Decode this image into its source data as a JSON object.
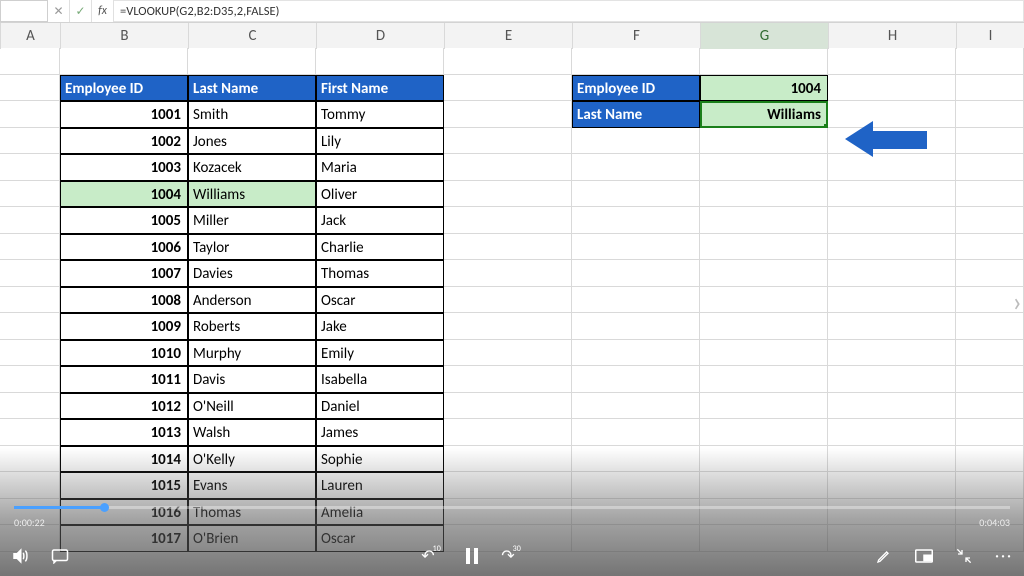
{
  "formula_bar": {
    "cancel_glyph": "✕",
    "accept_glyph": "✓",
    "fx_label": "fx",
    "formula": "=VLOOKUP(G2,B2:D35,2,FALSE)"
  },
  "columns": [
    "A",
    "B",
    "C",
    "D",
    "E",
    "F",
    "G",
    "H",
    "I"
  ],
  "selected_column": "G",
  "table": {
    "headers": [
      "Employee ID",
      "Last Name",
      "First Name"
    ],
    "rows": [
      {
        "id": "1001",
        "last": "Smith",
        "first": "Tommy"
      },
      {
        "id": "1002",
        "last": "Jones",
        "first": "Lily"
      },
      {
        "id": "1003",
        "last": "Kozacek",
        "first": "Maria"
      },
      {
        "id": "1004",
        "last": "Williams",
        "first": "Oliver",
        "highlight": true
      },
      {
        "id": "1005",
        "last": "Miller",
        "first": "Jack"
      },
      {
        "id": "1006",
        "last": "Taylor",
        "first": "Charlie"
      },
      {
        "id": "1007",
        "last": "Davies",
        "first": "Thomas"
      },
      {
        "id": "1008",
        "last": "Anderson",
        "first": "Oscar"
      },
      {
        "id": "1009",
        "last": "Roberts",
        "first": "Jake"
      },
      {
        "id": "1010",
        "last": "Murphy",
        "first": "Emily"
      },
      {
        "id": "1011",
        "last": "Davis",
        "first": "Isabella"
      },
      {
        "id": "1012",
        "last": "O'Neill",
        "first": "Daniel"
      },
      {
        "id": "1013",
        "last": "Walsh",
        "first": "James"
      },
      {
        "id": "1014",
        "last": "O'Kelly",
        "first": "Sophie"
      },
      {
        "id": "1015",
        "last": "Evans",
        "first": "Lauren"
      },
      {
        "id": "1016",
        "last": "Thomas",
        "first": "Amelia"
      },
      {
        "id": "1017",
        "last": "O'Brien",
        "first": "Oscar"
      }
    ]
  },
  "lookup": {
    "label_id": "Employee ID",
    "value_id": "1004",
    "label_name": "Last Name",
    "value_name": "Williams"
  },
  "overlay": {
    "time_current": "0:00:22",
    "time_total": "0:04:03",
    "progress_pct": 9,
    "back_label": "10",
    "fwd_label": "30"
  }
}
